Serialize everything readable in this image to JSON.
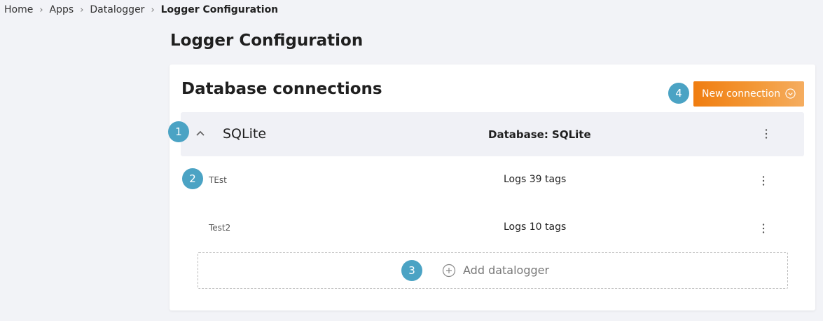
{
  "breadcrumb": {
    "items": [
      "Home",
      "Apps",
      "Datalogger"
    ],
    "current": "Logger Configuration"
  },
  "page": {
    "title": "Logger Configuration"
  },
  "card": {
    "title": "Database connections",
    "new_connection_label": "New connection"
  },
  "connection": {
    "name": "SQLite",
    "database_label": "Database: SQLite"
  },
  "loggers": [
    {
      "name": "TEst",
      "tags": "Logs 39 tags"
    },
    {
      "name": "Test2",
      "tags": "Logs 10 tags"
    }
  ],
  "add_datalogger_label": "Add datalogger",
  "badges": [
    "1",
    "2",
    "3",
    "4"
  ],
  "colors": {
    "accent": "#f07d10",
    "badge": "#4ba3c4",
    "background": "#f2f3f7"
  },
  "icons": {
    "breadcrumb_sep": "chevron-right-icon",
    "collapse": "chevron-up-icon",
    "menu": "more-vertical-icon",
    "dropdown": "chevron-down-circle-icon",
    "add": "plus-circle-icon"
  }
}
